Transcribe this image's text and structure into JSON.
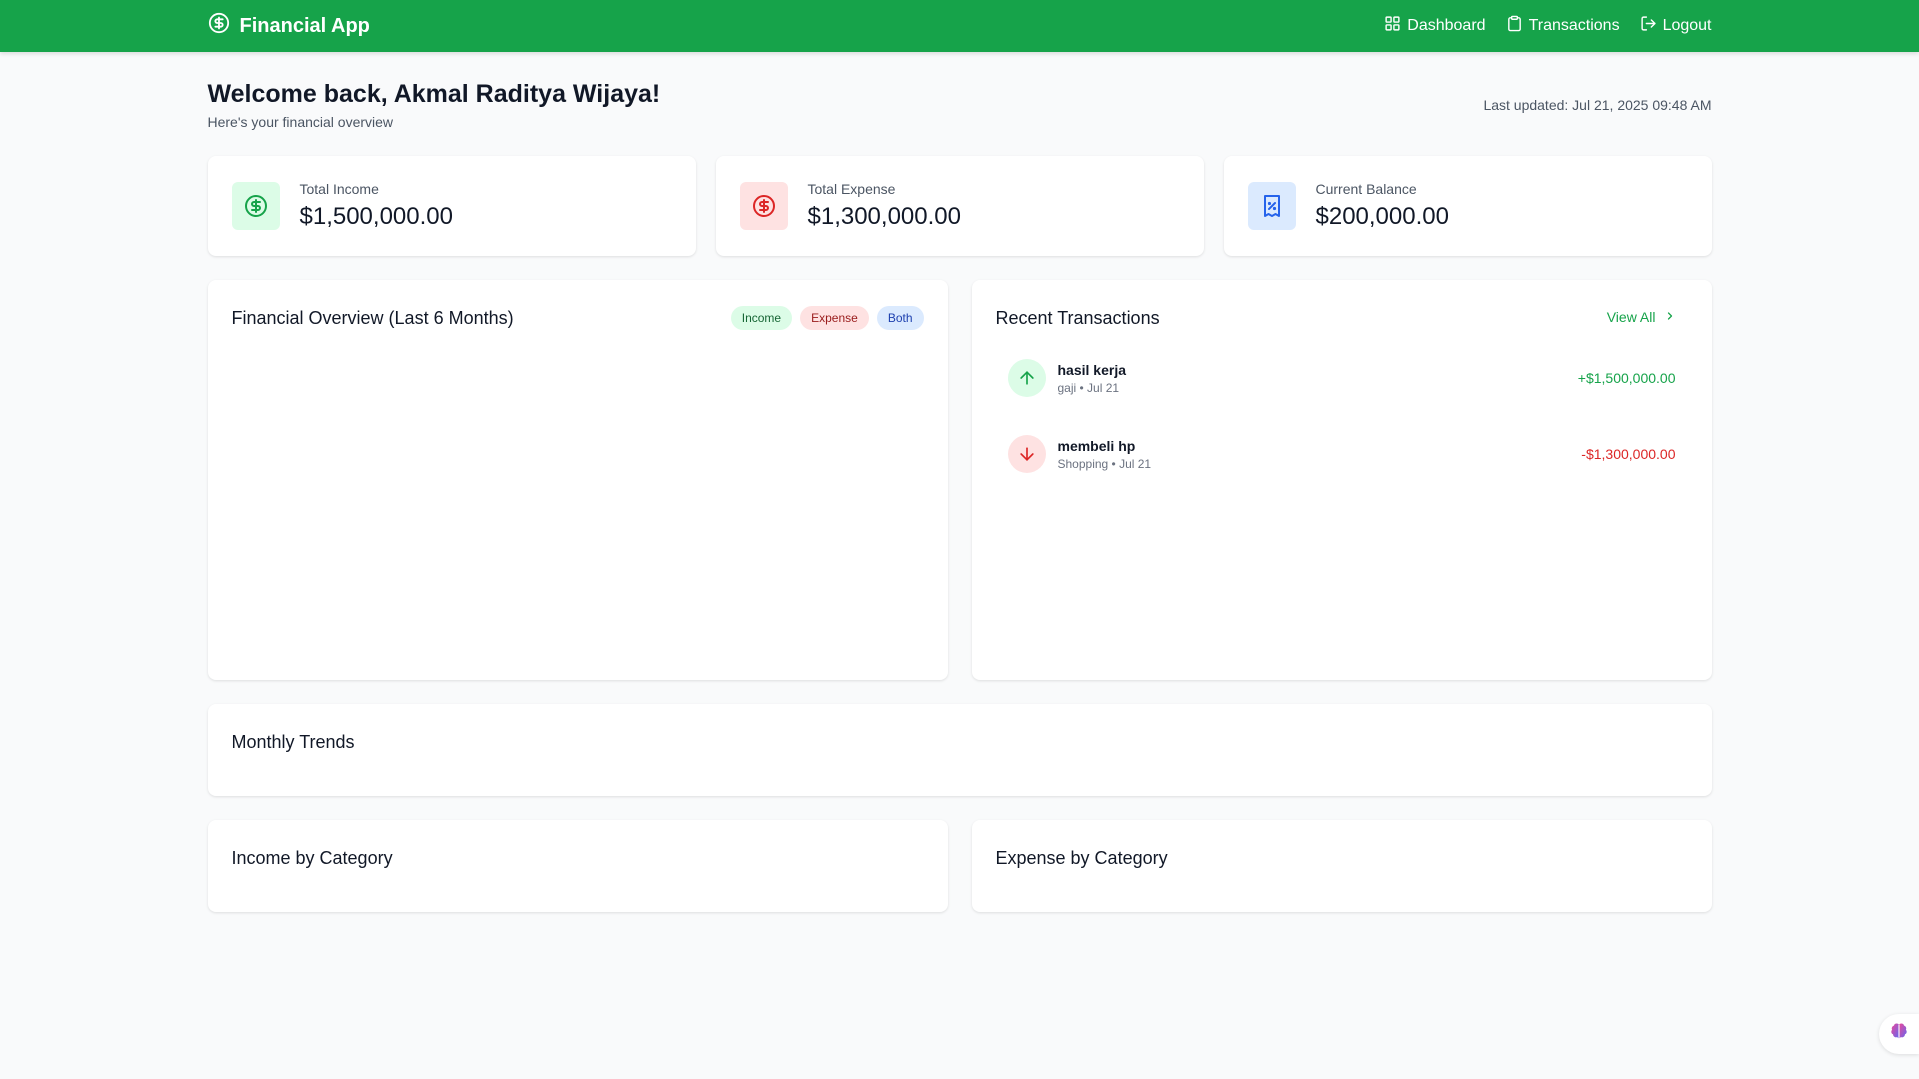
{
  "nav": {
    "brand": "Financial App",
    "links": [
      {
        "label": "Dashboard",
        "icon": "grid-icon"
      },
      {
        "label": "Transactions",
        "icon": "clipboard-icon"
      },
      {
        "label": "Logout",
        "icon": "logout-icon"
      }
    ],
    "color": "#16a34a"
  },
  "header": {
    "welcome": "Welcome back, Akmal Raditya Wijaya!",
    "subtitle": "Here's your financial overview",
    "last_updated": "Last updated: Jul 21, 2025 09:48 AM"
  },
  "stats": [
    {
      "label": "Total Income",
      "value": "$1,500,000.00",
      "icon": "dollar-circle-icon",
      "color": "#16a34a",
      "bg": "#dcfce7"
    },
    {
      "label": "Total Expense",
      "value": "$1,300,000.00",
      "icon": "dollar-circle-icon",
      "color": "#dc2626",
      "bg": "#fee2e2"
    },
    {
      "label": "Current Balance",
      "value": "$200,000.00",
      "icon": "receipt-icon",
      "color": "#2563eb",
      "bg": "#dbeafe"
    }
  ],
  "overview": {
    "title": "Financial Overview (Last 6 Months)",
    "filters": [
      "Income",
      "Expense",
      "Both"
    ]
  },
  "recent": {
    "title": "Recent Transactions",
    "view_all": "View All",
    "items": [
      {
        "name": "hasil kerja",
        "meta": "gaji • Jul 21",
        "amount": "+$1,500,000.00",
        "type": "income",
        "color": "#16a34a"
      },
      {
        "name": "membeli hp",
        "meta": "Shopping • Jul 21",
        "amount": "-$1,300,000.00",
        "type": "expense",
        "color": "#dc2626"
      }
    ]
  },
  "monthly_trends": {
    "title": "Monthly Trends"
  },
  "income_by_category": {
    "title": "Income by Category"
  },
  "expense_by_category": {
    "title": "Expense by Category"
  }
}
